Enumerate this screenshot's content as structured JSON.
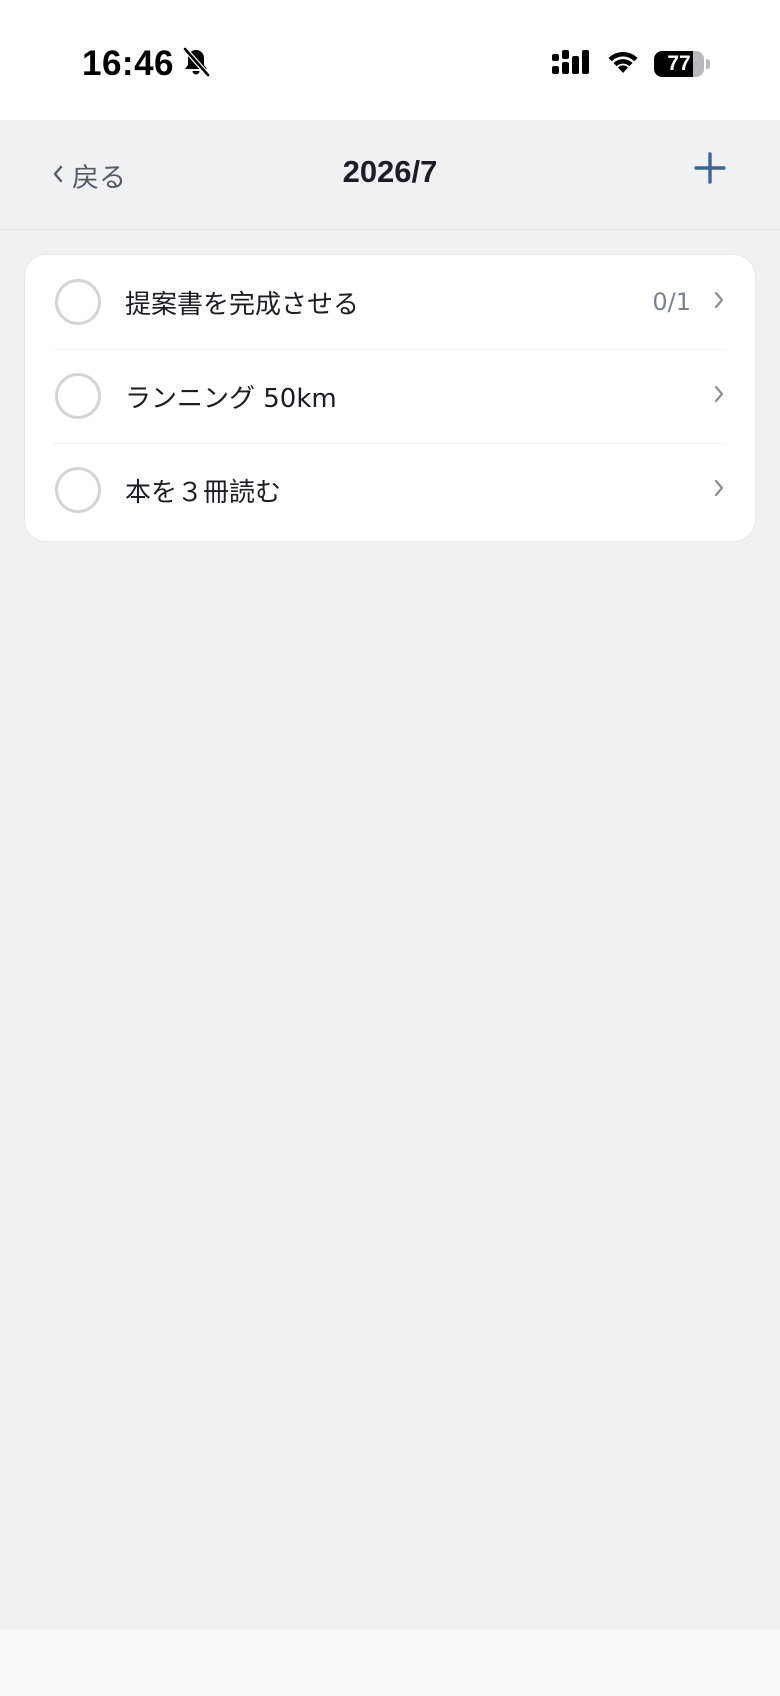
{
  "status_bar": {
    "time": "16:46",
    "battery_level": "77",
    "battery_fraction": 0.77,
    "icons": [
      "bell-slash-icon",
      "cellular-signal-icon",
      "wifi-icon",
      "battery-icon"
    ]
  },
  "nav": {
    "back_label": "戻る",
    "title": "2026/7",
    "add_icon": "plus-icon"
  },
  "list": {
    "items": [
      {
        "label": "提案書を完成させる",
        "count": "0/1"
      },
      {
        "label": "ランニング 50km",
        "count": ""
      },
      {
        "label": "本を３冊読む",
        "count": ""
      }
    ]
  },
  "colors": {
    "accent": "#3d6690",
    "background": "#f0f1f3",
    "card": "#ffffff",
    "circle_border": "#d3d4d9"
  }
}
